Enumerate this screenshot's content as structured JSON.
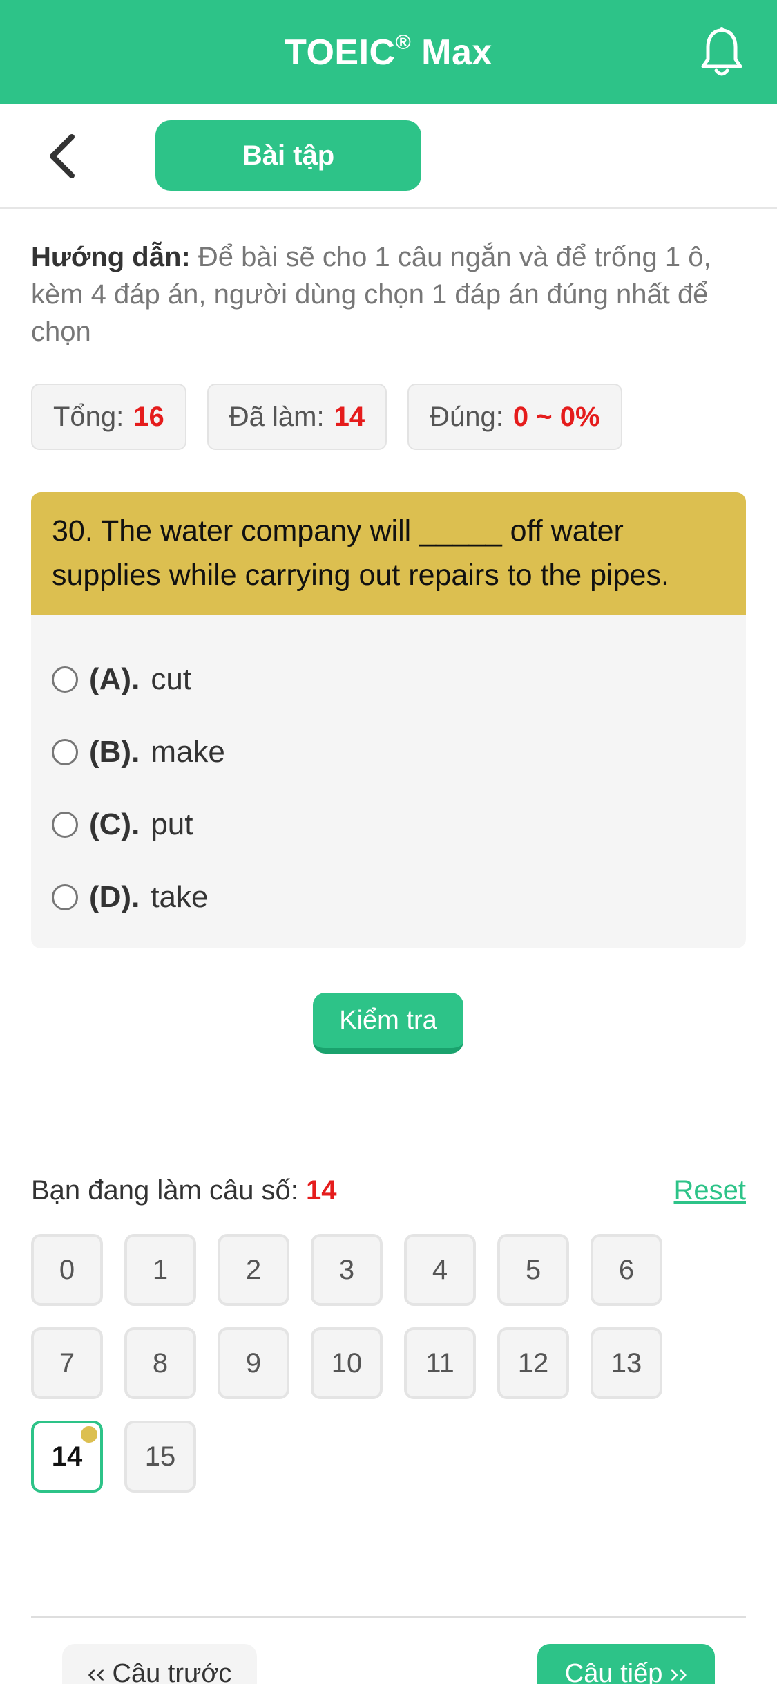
{
  "header": {
    "title": "TOEIC",
    "title_mark": "®",
    "title_suffix": " Max",
    "notification_icon": "bell-icon"
  },
  "subheader": {
    "back_icon": "chevron-left-icon",
    "tab_label": "Bài tập"
  },
  "instructions": {
    "label": "Hướng dẫn:",
    "text": " Để bài sẽ cho 1 câu ngắn và để trống 1 ô, kèm 4 đáp án, người dùng chọn 1 đáp án đúng nhất để chọn"
  },
  "stats": {
    "total_label": "Tổng:",
    "total_value": "16",
    "done_label": "Đã làm:",
    "done_value": "14",
    "correct_label": "Đúng:",
    "correct_value": "0 ~ 0%"
  },
  "question": {
    "text": "30. The water company will _____ off water supplies while carrying out repairs to the pipes.",
    "options": [
      {
        "letter": "(A).",
        "text": "cut"
      },
      {
        "letter": "(B).",
        "text": "make"
      },
      {
        "letter": "(C).",
        "text": "put"
      },
      {
        "letter": "(D).",
        "text": "take"
      }
    ]
  },
  "check_button": "Kiểm tra",
  "progress": {
    "label": "Bạn đang làm câu số:",
    "current": "14",
    "reset_label": "Reset",
    "cells": [
      "0",
      "1",
      "2",
      "3",
      "4",
      "5",
      "6",
      "7",
      "8",
      "9",
      "10",
      "11",
      "12",
      "13",
      "14",
      "15"
    ]
  },
  "navigation": {
    "prev_label": "‹‹ Câu trước",
    "next_label": "Câu tiếp ››"
  },
  "colors": {
    "primary": "#2dc388",
    "question_header": "#dcbf50",
    "highlight_number": "#e51c1c"
  }
}
